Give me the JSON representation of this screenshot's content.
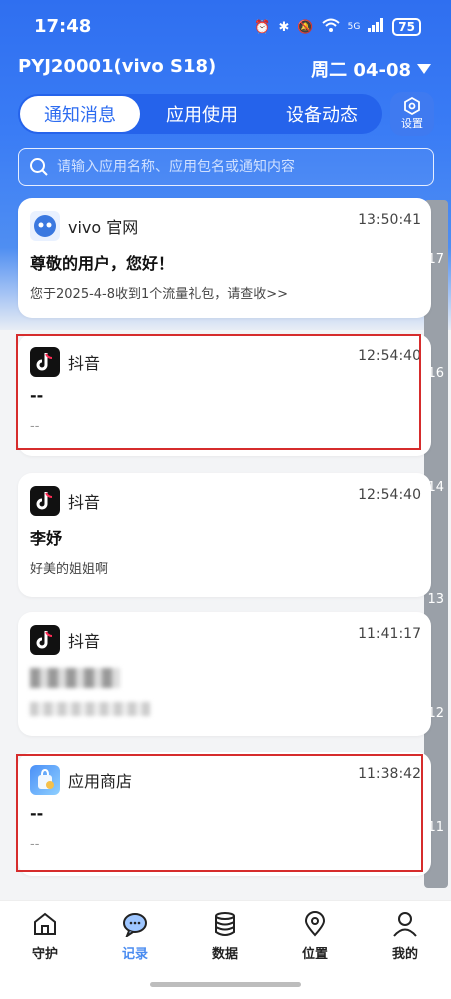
{
  "status": {
    "time": "17:48",
    "battery": "75",
    "net": "5G"
  },
  "header": {
    "device": "PYJ20001(vivo S18)",
    "date": "周二 04-08"
  },
  "tabs": [
    {
      "label": "通知消息"
    },
    {
      "label": "应用使用"
    },
    {
      "label": "设备动态"
    }
  ],
  "settings_label": "设置",
  "search": {
    "placeholder": "请输入应用名称、应用包名或通知内容"
  },
  "timeline": [
    "17",
    "16",
    "14",
    "13",
    "12",
    "11"
  ],
  "cards": [
    {
      "app": "vivo 官网",
      "time": "13:50:41",
      "title": "尊敬的用户，您好！",
      "body": "您于2025-4-8收到1个流量礼包，请查收>>"
    },
    {
      "app": "抖音",
      "time": "12:54:40",
      "title": "--",
      "body": "--"
    },
    {
      "app": "抖音",
      "time": "12:54:40",
      "title": "李妤",
      "body": "好美的姐姐啊"
    },
    {
      "app": "抖音",
      "time": "11:41:17",
      "title": "",
      "body": ""
    },
    {
      "app": "应用商店",
      "time": "11:38:42",
      "title": "--",
      "body": "--"
    }
  ],
  "nav": [
    {
      "label": "守护"
    },
    {
      "label": "记录"
    },
    {
      "label": "数据"
    },
    {
      "label": "位置"
    },
    {
      "label": "我的"
    }
  ]
}
